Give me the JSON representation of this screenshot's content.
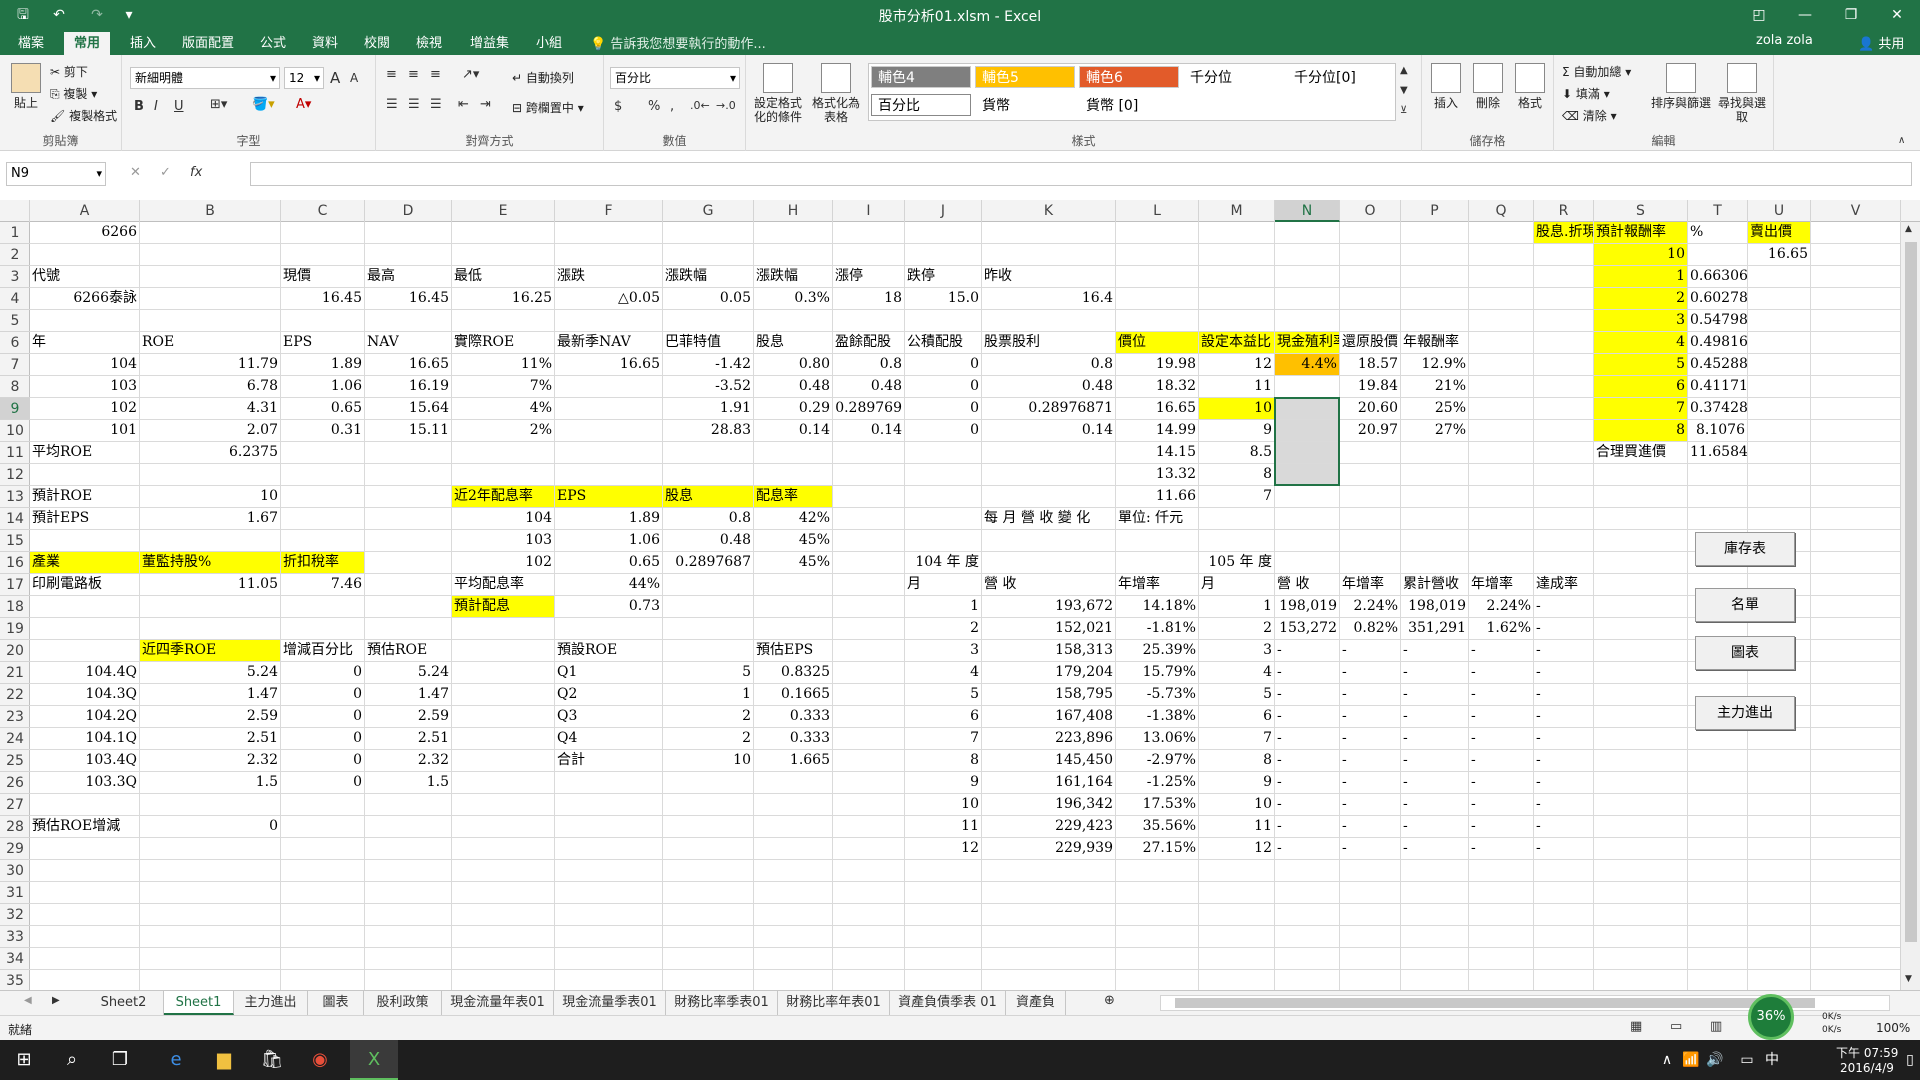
{
  "title": "股市分析01.xlsm - Excel",
  "qat": {
    "save": "🖫",
    "undo": "↶",
    "redo": "↷",
    "more": "▾"
  },
  "window_buttons": {
    "opts": "◰",
    "min": "—",
    "max": "❐",
    "close": "✕"
  },
  "ribbon_tabs": [
    "檔案",
    "常用",
    "插入",
    "版面配置",
    "公式",
    "資料",
    "校閱",
    "檢視",
    "增益集",
    "小組"
  ],
  "tell_me": "告訴我您想要執行的動作...",
  "user_name": "zola zola",
  "share": "共用",
  "ribbon": {
    "clipboard": {
      "paste": "貼上",
      "cut": "剪下",
      "copy": "複製",
      "format_painter": "複製格式",
      "label": "剪貼簿"
    },
    "font": {
      "name": "新細明體",
      "size": "12",
      "label": "字型",
      "grow": "A",
      "shrink": "A",
      "bold": "B",
      "italic": "I",
      "underline": "U"
    },
    "align": {
      "wrap": "自動換列",
      "merge": "跨欄置中",
      "label": "對齊方式"
    },
    "number": {
      "format": "百分比",
      "currency": "$",
      "percent": "%",
      "comma": ",",
      "label": "數值"
    },
    "styles": {
      "cond": "設定格式化的條件",
      "table": "格式化為表格",
      "items": [
        "輔色4",
        "輔色5",
        "輔色6",
        "千分位",
        "千分位[0]",
        "百分比",
        "貨幣",
        "貨幣 [0]"
      ],
      "label": "樣式"
    },
    "cells": {
      "insert": "插入",
      "delete": "刪除",
      "format": "格式",
      "label": "儲存格"
    },
    "editing": {
      "autosum": "自動加總",
      "fill": "填滿",
      "clear": "清除",
      "sort": "排序與篩選",
      "find": "尋找與選取",
      "label": "編輯"
    }
  },
  "name_box": "N9",
  "columns": [
    "A",
    "B",
    "C",
    "D",
    "E",
    "F",
    "G",
    "H",
    "I",
    "J",
    "K",
    "L",
    "M",
    "N",
    "O",
    "P",
    "Q",
    "R",
    "S",
    "T",
    "U",
    "V"
  ],
  "rows": [
    "1",
    "2",
    "3",
    "4",
    "5",
    "6",
    "7",
    "8",
    "9",
    "10",
    "11",
    "12",
    "13",
    "14",
    "15",
    "16",
    "17",
    "18",
    "19",
    "20",
    "21",
    "22",
    "23",
    "24",
    "25",
    "26",
    "27",
    "28",
    "29",
    "30",
    "31",
    "32",
    "33",
    "34",
    "35"
  ],
  "cells": {
    "r1": {
      "a": "6266",
      "r": "股息.折現",
      "s": "預計報酬率",
      "t": "%",
      "u": "賣出價"
    },
    "r2": {
      "s": "10",
      "u": "16.65"
    },
    "r3": {
      "a": "代號",
      "c": "現價",
      "d": "最高",
      "e": "最低",
      "f": "漲跌",
      "g": "漲跌幅",
      "h": "漲跌幅",
      "i": "漲停",
      "j": "跌停",
      "k": "昨收",
      "s": "1",
      "t": "0.66306"
    },
    "r4": {
      "a": "6266泰詠",
      "c": "16.45",
      "d": "16.45",
      "e": "16.25",
      "f": "△0.05",
      "g": "0.05",
      "h": "0.3%",
      "i": "18",
      "j": "15.0",
      "k": "16.4",
      "s": "2",
      "t": "0.60278"
    },
    "r5": {
      "s": "3",
      "t": "0.54798"
    },
    "r6": {
      "a": "年",
      "b": "ROE",
      "c": "EPS",
      "d": "NAV",
      "e": "實際ROE",
      "f": "最新季NAV",
      "g": "巴菲特值",
      "h": "股息",
      "i": "盈餘配股",
      "j": "公積配股",
      "k": "股票股利",
      "l": "價位",
      "m": "設定本益比",
      "n": "現金殖利率",
      "o": "還原股價",
      "p": "年報酬率",
      "s": "4",
      "t": "0.49816"
    },
    "r7": {
      "a": "104",
      "b": "11.79",
      "c": "1.89",
      "d": "16.65",
      "e": "11%",
      "f": "16.65",
      "g": "-1.42",
      "h": "0.80",
      "i": "0.8",
      "j": "0",
      "k": "0.8",
      "l": "19.98",
      "m": "12",
      "n": "4.4%",
      "o": "18.57",
      "p": "12.9%",
      "s": "5",
      "t": "0.45288"
    },
    "r8": {
      "a": "103",
      "b": "6.78",
      "c": "1.06",
      "d": "16.19",
      "e": "7%",
      "g": "-3.52",
      "h": "0.48",
      "i": "0.48",
      "j": "0",
      "k": "0.48",
      "l": "18.32",
      "m": "11",
      "o": "19.84",
      "p": "21%",
      "s": "6",
      "t": "0.41171"
    },
    "r9": {
      "a": "102",
      "b": "4.31",
      "c": "0.65",
      "d": "15.64",
      "e": "4%",
      "g": "1.91",
      "h": "0.29",
      "i": "0.289769",
      "j": "0",
      "k": "0.28976871",
      "l": "16.65",
      "m": "10",
      "o": "20.60",
      "p": "25%",
      "s": "7",
      "t": "0.37428"
    },
    "r10": {
      "a": "101",
      "b": "2.07",
      "c": "0.31",
      "d": "15.11",
      "e": "2%",
      "g": "28.83",
      "h": "0.14",
      "i": "0.14",
      "j": "0",
      "k": "0.14",
      "l": "14.99",
      "m": "9",
      "o": "20.97",
      "p": "27%",
      "s": "8",
      "t": "8.1076"
    },
    "r11": {
      "a": "平均ROE",
      "b": "6.2375",
      "l": "14.15",
      "m": "8.5",
      "s": "合理買進價",
      "t": "11.6584"
    },
    "r12": {
      "l": "13.32",
      "m": "8"
    },
    "r13": {
      "a": "預計ROE",
      "b": "10",
      "e": "近2年配息率",
      "f": "EPS",
      "g": "股息",
      "h": "配息率",
      "l": "11.66",
      "m": "7"
    },
    "r14": {
      "a": "預計EPS",
      "b": "1.67",
      "e": "104",
      "f": "1.89",
      "g": "0.8",
      "h": "42%",
      "k": "每 月 營 收 變 化",
      "l": "單位: 仟元"
    },
    "r15": {
      "e": "103",
      "f": "1.06",
      "g": "0.48",
      "h": "45%"
    },
    "r16": {
      "a": "產業",
      "b": "董監持股%",
      "c": "折扣稅率",
      "e": "102",
      "f": "0.65",
      "g": "0.2897687",
      "h": "45%",
      "j": "104 年 度",
      "m": "105 年 度"
    },
    "r17": {
      "a": "印刷電路板",
      "b": "11.05",
      "c": "7.46",
      "e": "平均配息率",
      "f": "44%",
      "j": "月",
      "k": "營 收",
      "l": "年增率",
      "m": "月",
      "n": "營 收",
      "o": "年增率",
      "p": "累計營收",
      "q": "年增率",
      "r": "達成率"
    },
    "r18": {
      "e": "預計配息",
      "f": "0.73",
      "j": "1",
      "k": "193,672",
      "l": "14.18%",
      "m": "1",
      "n": "198,019",
      "o": "2.24%",
      "p": "198,019",
      "q": "2.24%",
      "r": "-"
    },
    "r19": {
      "j": "2",
      "k": "152,021",
      "l": "-1.81%",
      "m": "2",
      "n": "153,272",
      "o": "0.82%",
      "p": "351,291",
      "q": "1.62%",
      "r": "-"
    },
    "r20": {
      "b": "近四季ROE",
      "c": "增減百分比",
      "d": "預估ROE",
      "f": "預設ROE",
      "h": "預估EPS",
      "j": "3",
      "k": "158,313",
      "l": "25.39%",
      "m": "3",
      "n": "-",
      "o": "-",
      "p": "-",
      "q": "-",
      "r": "-"
    },
    "r21": {
      "a": "104.4Q",
      "b": "5.24",
      "c": "0",
      "d": "5.24",
      "f": "Q1",
      "g": "5",
      "h": "0.8325",
      "j": "4",
      "k": "179,204",
      "l": "15.79%",
      "m": "4",
      "n": "-",
      "o": "-",
      "p": "-",
      "q": "-",
      "r": "-"
    },
    "r22": {
      "a": "104.3Q",
      "b": "1.47",
      "c": "0",
      "d": "1.47",
      "f": "Q2",
      "g": "1",
      "h": "0.1665",
      "j": "5",
      "k": "158,795",
      "l": "-5.73%",
      "m": "5",
      "n": "-",
      "o": "-",
      "p": "-",
      "q": "-",
      "r": "-"
    },
    "r23": {
      "a": "104.2Q",
      "b": "2.59",
      "c": "0",
      "d": "2.59",
      "f": "Q3",
      "g": "2",
      "h": "0.333",
      "j": "6",
      "k": "167,408",
      "l": "-1.38%",
      "m": "6",
      "n": "-",
      "o": "-",
      "p": "-",
      "q": "-",
      "r": "-"
    },
    "r24": {
      "a": "104.1Q",
      "b": "2.51",
      "c": "0",
      "d": "2.51",
      "f": "Q4",
      "g": "2",
      "h": "0.333",
      "j": "7",
      "k": "223,896",
      "l": "13.06%",
      "m": "7",
      "n": "-",
      "o": "-",
      "p": "-",
      "q": "-",
      "r": "-"
    },
    "r25": {
      "a": "103.4Q",
      "b": "2.32",
      "c": "0",
      "d": "2.32",
      "f": "合計",
      "g": "10",
      "h": "1.665",
      "j": "8",
      "k": "145,450",
      "l": "-2.97%",
      "m": "8",
      "n": "-",
      "o": "-",
      "p": "-",
      "q": "-",
      "r": "-"
    },
    "r26": {
      "a": "103.3Q",
      "b": "1.5",
      "c": "0",
      "d": "1.5",
      "j": "9",
      "k": "161,164",
      "l": "-1.25%",
      "m": "9",
      "n": "-",
      "o": "-",
      "p": "-",
      "q": "-",
      "r": "-"
    },
    "r27": {
      "j": "10",
      "k": "196,342",
      "l": "17.53%",
      "m": "10",
      "n": "-",
      "o": "-",
      "p": "-",
      "q": "-",
      "r": "-"
    },
    "r28": {
      "a": "預估ROE增減",
      "b": "0",
      "j": "11",
      "k": "229,423",
      "l": "35.56%",
      "m": "11",
      "n": "-",
      "o": "-",
      "p": "-",
      "q": "-",
      "r": "-"
    },
    "r29": {
      "j": "12",
      "k": "229,939",
      "l": "27.15%",
      "m": "12",
      "n": "-",
      "o": "-",
      "p": "-",
      "q": "-",
      "r": "-"
    }
  },
  "sheet_buttons": {
    "inventory": "庫存表",
    "list": "名單",
    "chart": "圖表",
    "main_force": "主力進出"
  },
  "sheet_tabs": [
    "Sheet2",
    "Sheet1",
    "主力進出",
    "圖表",
    "股利政策",
    "現金流量年表01",
    "現金流量季表01",
    "財務比率季表01",
    "財務比率年表01",
    "資產負債季表 01",
    "資產負"
  ],
  "status": {
    "ready": "就緒",
    "zoom": "100%",
    "cpu": "36%",
    "net_up": "0K/s",
    "net_down": "0K/s"
  },
  "taskbar": {
    "time": "下午 07:59",
    "date": "2016/4/9",
    "ime": "中"
  }
}
